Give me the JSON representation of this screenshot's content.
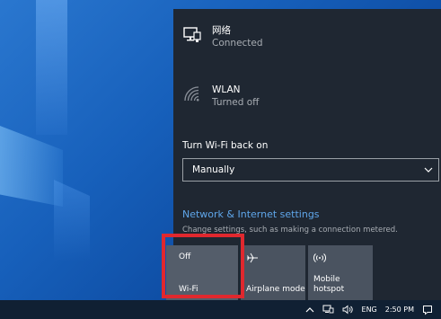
{
  "network": {
    "wired": {
      "name": "网络",
      "status": "Connected",
      "icon": "ethernet-icon"
    },
    "wlan": {
      "name": "WLAN",
      "status": "Turned off",
      "icon": "wifi-off-icon"
    }
  },
  "wifi_back_on": {
    "label": "Turn Wi-Fi back on",
    "selected": "Manually"
  },
  "settings": {
    "link": "Network & Internet settings",
    "description": "Change settings, such as making a connection metered."
  },
  "quick_actions": [
    {
      "state": "Off",
      "label": "Wi-Fi"
    },
    {
      "label": "Airplane mode",
      "icon": "airplane-icon"
    },
    {
      "label_line1": "Mobile",
      "label_line2": "hotspot",
      "icon": "hotspot-icon"
    }
  ],
  "taskbar": {
    "language": "ENG",
    "time": "2:50 PM"
  },
  "colors": {
    "panel_bg": "#1f2732",
    "tile_bg": "#4a5360",
    "link": "#5fa6ea",
    "highlight": "#e0282e"
  }
}
